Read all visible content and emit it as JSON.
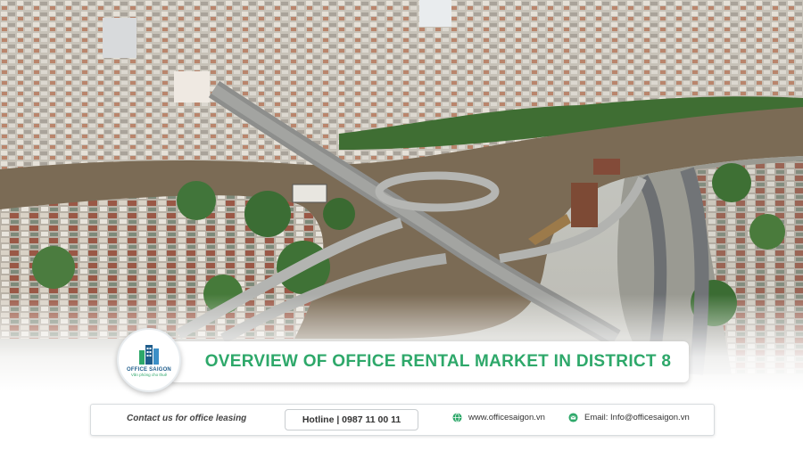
{
  "title": "OVERVIEW OF OFFICE RENTAL MARKET IN DISTRICT 8",
  "logo": {
    "name": "OFFICE SAIGON",
    "tagline": "Văn phòng cho thuê"
  },
  "contact": {
    "label": "Contact us for office leasing",
    "hotline": "Hotline | 0987 11 00 11",
    "website": "www.officesaigon.vn",
    "email": "Email: Info@officesaigon.vn"
  },
  "icons": [
    "globe-icon",
    "email-icon",
    "building-logo-icon"
  ],
  "colors": {
    "accent": "#2ea86a",
    "logo_blue": "#1f5d8c"
  }
}
